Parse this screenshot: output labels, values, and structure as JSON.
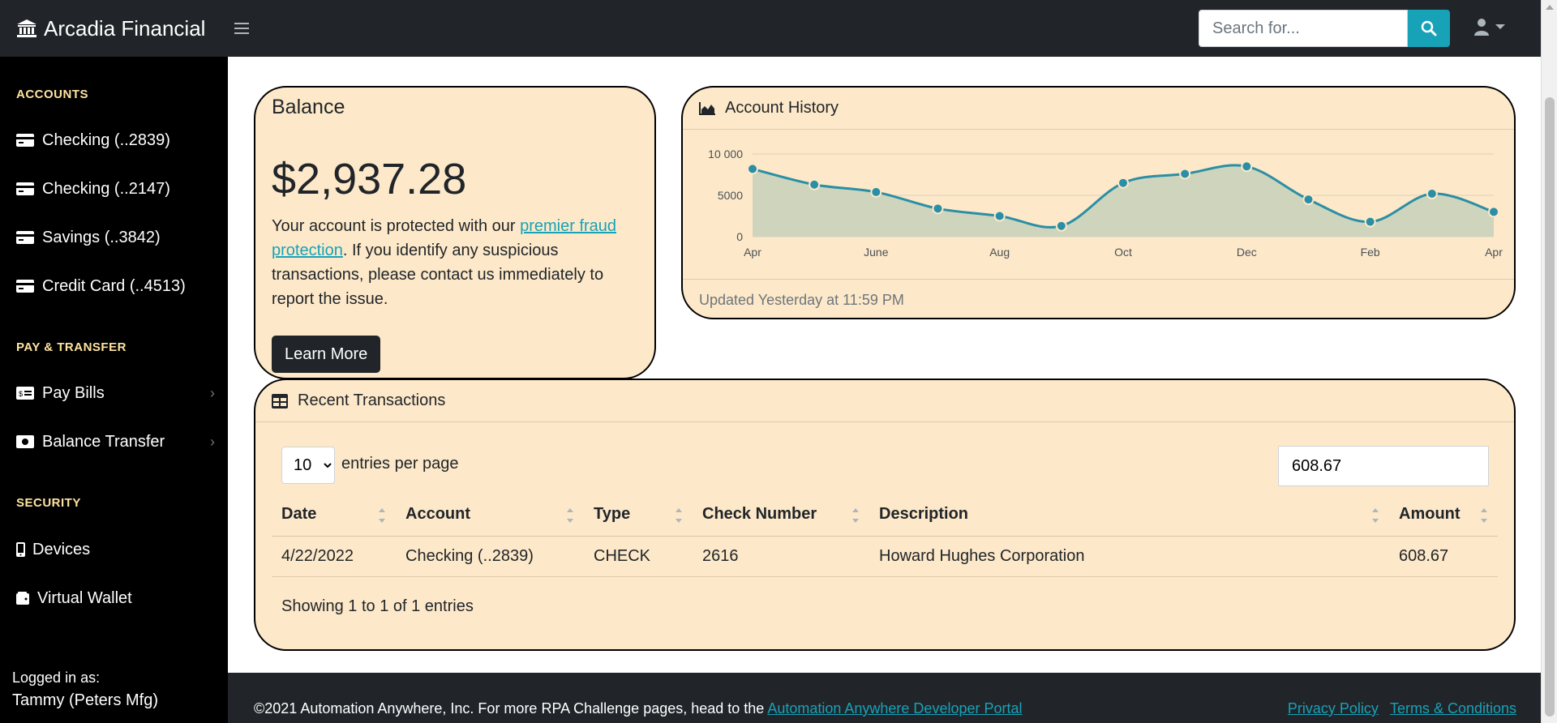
{
  "app": {
    "title": "Arcadia Financial"
  },
  "topbar": {
    "search_placeholder": "Search for...",
    "search_value": ""
  },
  "sidebar": {
    "accounts_heading": "ACCOUNTS",
    "accounts": [
      {
        "label": "Checking (..2839)"
      },
      {
        "label": "Checking (..2147)"
      },
      {
        "label": "Savings (..3842)"
      },
      {
        "label": "Credit Card (..4513)"
      }
    ],
    "pay_heading": "PAY & TRANSFER",
    "pay_items": [
      {
        "label": "Pay Bills"
      },
      {
        "label": "Balance Transfer"
      }
    ],
    "security_heading": "SECURITY",
    "security_items": [
      {
        "label": "Devices"
      },
      {
        "label": "Virtual Wallet"
      }
    ],
    "logged_in_label": "Logged in as:",
    "logged_in_user": "Tammy (Peters Mfg)"
  },
  "balance": {
    "title": "Balance",
    "amount": "$2,937.28",
    "text_before_link": "Your account is protected with our ",
    "link_text": "premier fraud protection",
    "text_after_link": ". If you identify any suspicious transactions, please contact us immediately to report the issue.",
    "button_label": "Learn More"
  },
  "history": {
    "title": "Account History",
    "updated": "Updated Yesterday at 11:59 PM",
    "chart_data": {
      "type": "area",
      "x_tick_labels": [
        "Apr",
        "June",
        "Aug",
        "Oct",
        "Dec",
        "Feb",
        "Apr"
      ],
      "y_tick_labels": [
        "10 000",
        "5000",
        "0"
      ],
      "ylim": [
        0,
        10000
      ],
      "y_ticks": [
        0,
        5000,
        10000
      ],
      "values": [
        8200,
        6300,
        5400,
        3400,
        2500,
        1300,
        6500,
        7600,
        8500,
        4500,
        1800,
        5200,
        3000
      ],
      "grid": true,
      "line_color": "#2a8fa6",
      "fill_color": "#ccd3bd"
    }
  },
  "transactions": {
    "title": "Recent Transactions",
    "entries_value": "10",
    "entries_options": [
      "10"
    ],
    "entries_label": "entries per page",
    "search_value": "608.67",
    "columns": [
      "Date",
      "Account",
      "Type",
      "Check Number",
      "Description",
      "Amount"
    ],
    "rows": [
      [
        "4/22/2022",
        "Checking (..2839)",
        "CHECK",
        "2616",
        "Howard Hughes Corporation",
        "608.67"
      ]
    ],
    "showing": "Showing 1 to 1 of 1 entries"
  },
  "footer": {
    "copyright": "©2021 Automation Anywhere, Inc. For more RPA Challenge pages, head to the ",
    "portal_link": "Automation Anywhere Developer Portal",
    "privacy": "Privacy Policy",
    "terms": "Terms & Conditions"
  },
  "colors": {
    "card_bg": "#fde9c9",
    "accent": "#17a2b8",
    "sidebar_heading": "#ffe4a0",
    "navbar": "#212529"
  }
}
